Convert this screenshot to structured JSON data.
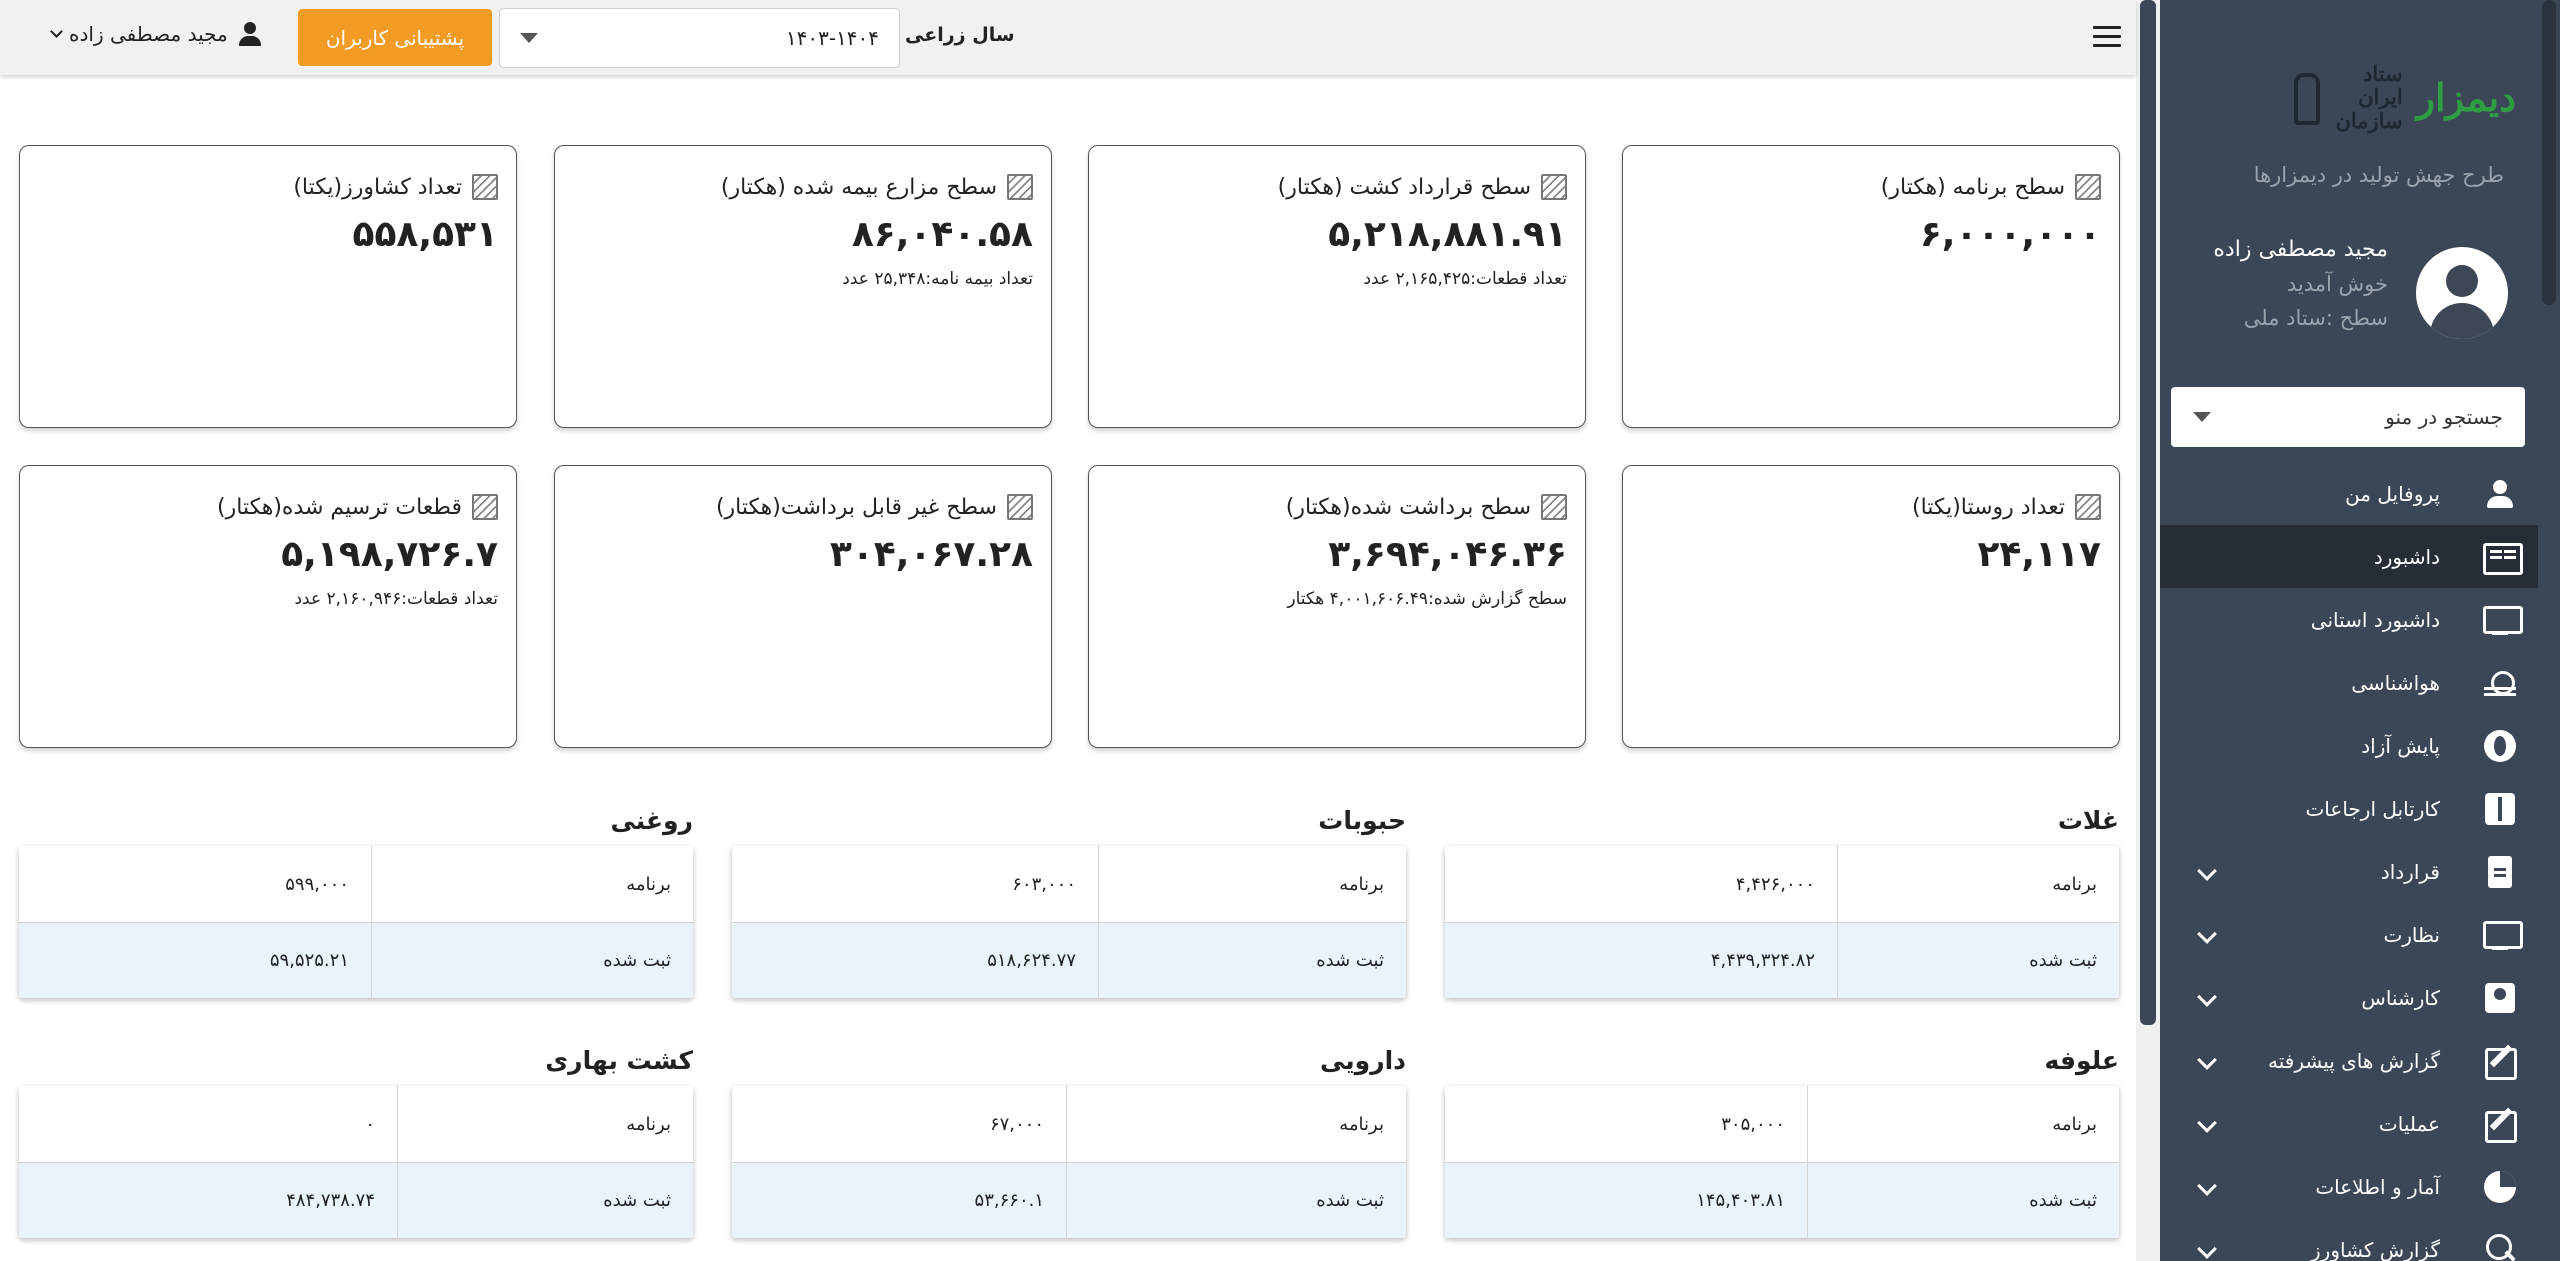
{
  "header": {
    "year_label": "سال زراعی",
    "year_value": "۱۴۰۳-۱۴۰۴",
    "support_label": "پشتیبانی کاربران",
    "user_name": "مجید مصطفی زاده"
  },
  "sidebar": {
    "logo_text_1": "ستاد ایران سازمان",
    "logo_text_2": "دیمزار",
    "subtitle": "طرح جهش تولید در دیمزارها",
    "profile": {
      "name": "مجید مصطفی زاده",
      "welcome": "خوش آمدید",
      "level": "سطح :ستاد ملی"
    },
    "search_placeholder": "جستجو در منو",
    "items": [
      {
        "label": "پروفایل من",
        "icon": "person-icon"
      },
      {
        "label": "داشبورد",
        "icon": "dashboard-icon"
      },
      {
        "label": "داشبورد استانی",
        "icon": "monitor-icon"
      },
      {
        "label": "هواشناسی",
        "icon": "weather-icon"
      },
      {
        "label": "پایش آزاد",
        "icon": "globe-icon"
      },
      {
        "label": "کارتابل ارجاعات",
        "icon": "kanban-icon"
      },
      {
        "label": "قرارداد",
        "icon": "document-icon"
      },
      {
        "label": "نظارت",
        "icon": "monitor-icon"
      },
      {
        "label": "کارشناس",
        "icon": "badge-icon"
      },
      {
        "label": "گزارش های پیشرفته",
        "icon": "edit-icon"
      },
      {
        "label": "عملیات",
        "icon": "edit-icon"
      },
      {
        "label": "آمار و اطلاعات",
        "icon": "pie-chart-icon"
      },
      {
        "label": "گزارش کشاورز",
        "icon": "search-icon"
      }
    ]
  },
  "cards": [
    {
      "title": "سطح برنامه (هکتار)",
      "value": "۶,۰۰۰,۰۰۰",
      "sub": ""
    },
    {
      "title": "سطح قرارداد کشت (هکتار)",
      "value": "۵,۲۱۸,۸۸۱.۹۱",
      "sub": "تعداد قطعات:۲,۱۶۵,۴۲۵ عدد"
    },
    {
      "title": "سطح مزارع بیمه شده (هکتار)",
      "value": "۸۶,۰۴۰.۵۸",
      "sub": "تعداد بیمه نامه:۲۵,۳۴۸ عدد"
    },
    {
      "title": "تعداد کشاورز(یکتا)",
      "value": "۵۵۸,۵۳۱",
      "sub": ""
    },
    {
      "title": "تعداد روستا(یکتا)",
      "value": "۲۴,۱۱۷",
      "sub": ""
    },
    {
      "title": "سطح برداشت شده(هکتار)",
      "value": "۳,۶۹۴,۰۴۶.۳۶",
      "sub": "سطح گزارش شده:۴,۰۰۱,۶۰۶.۴۹ هکتار"
    },
    {
      "title": "سطح غیر قابل برداشت(هکتار)",
      "value": "۳۰۴,۰۶۷.۲۸",
      "sub": ""
    },
    {
      "title": "قطعات ترسیم شده(هکتار)",
      "value": "۵,۱۹۸,۷۲۶.۷",
      "sub": "تعداد قطعات:۲,۱۶۰,۹۴۶ عدد"
    }
  ],
  "categories": [
    {
      "title": "غلات",
      "plan_label": "برنامه",
      "plan": "۴,۴۲۶,۰۰۰",
      "reg_label": "ثبت شده",
      "registered": "۴,۴۳۹,۳۲۴.۸۲"
    },
    {
      "title": "حبوبات",
      "plan_label": "برنامه",
      "plan": "۶۰۳,۰۰۰",
      "reg_label": "ثبت شده",
      "registered": "۵۱۸,۶۲۴.۷۷"
    },
    {
      "title": "روغنی",
      "plan_label": "برنامه",
      "plan": "۵۹۹,۰۰۰",
      "reg_label": "ثبت شده",
      "registered": "۵۹,۵۲۵.۲۱"
    },
    {
      "title": "علوفه",
      "plan_label": "برنامه",
      "plan": "۳۰۵,۰۰۰",
      "reg_label": "ثبت شده",
      "registered": "۱۴۵,۴۰۳.۸۱"
    },
    {
      "title": "دارویی",
      "plan_label": "برنامه",
      "plan": "۶۷,۰۰۰",
      "reg_label": "ثبت شده",
      "registered": "۵۳,۶۶۰.۱"
    },
    {
      "title": "کشت بهاری",
      "plan_label": "برنامه",
      "plan": "۰",
      "reg_label": "ثبت شده",
      "registered": "۴۸۴,۷۳۸.۷۴"
    }
  ]
}
